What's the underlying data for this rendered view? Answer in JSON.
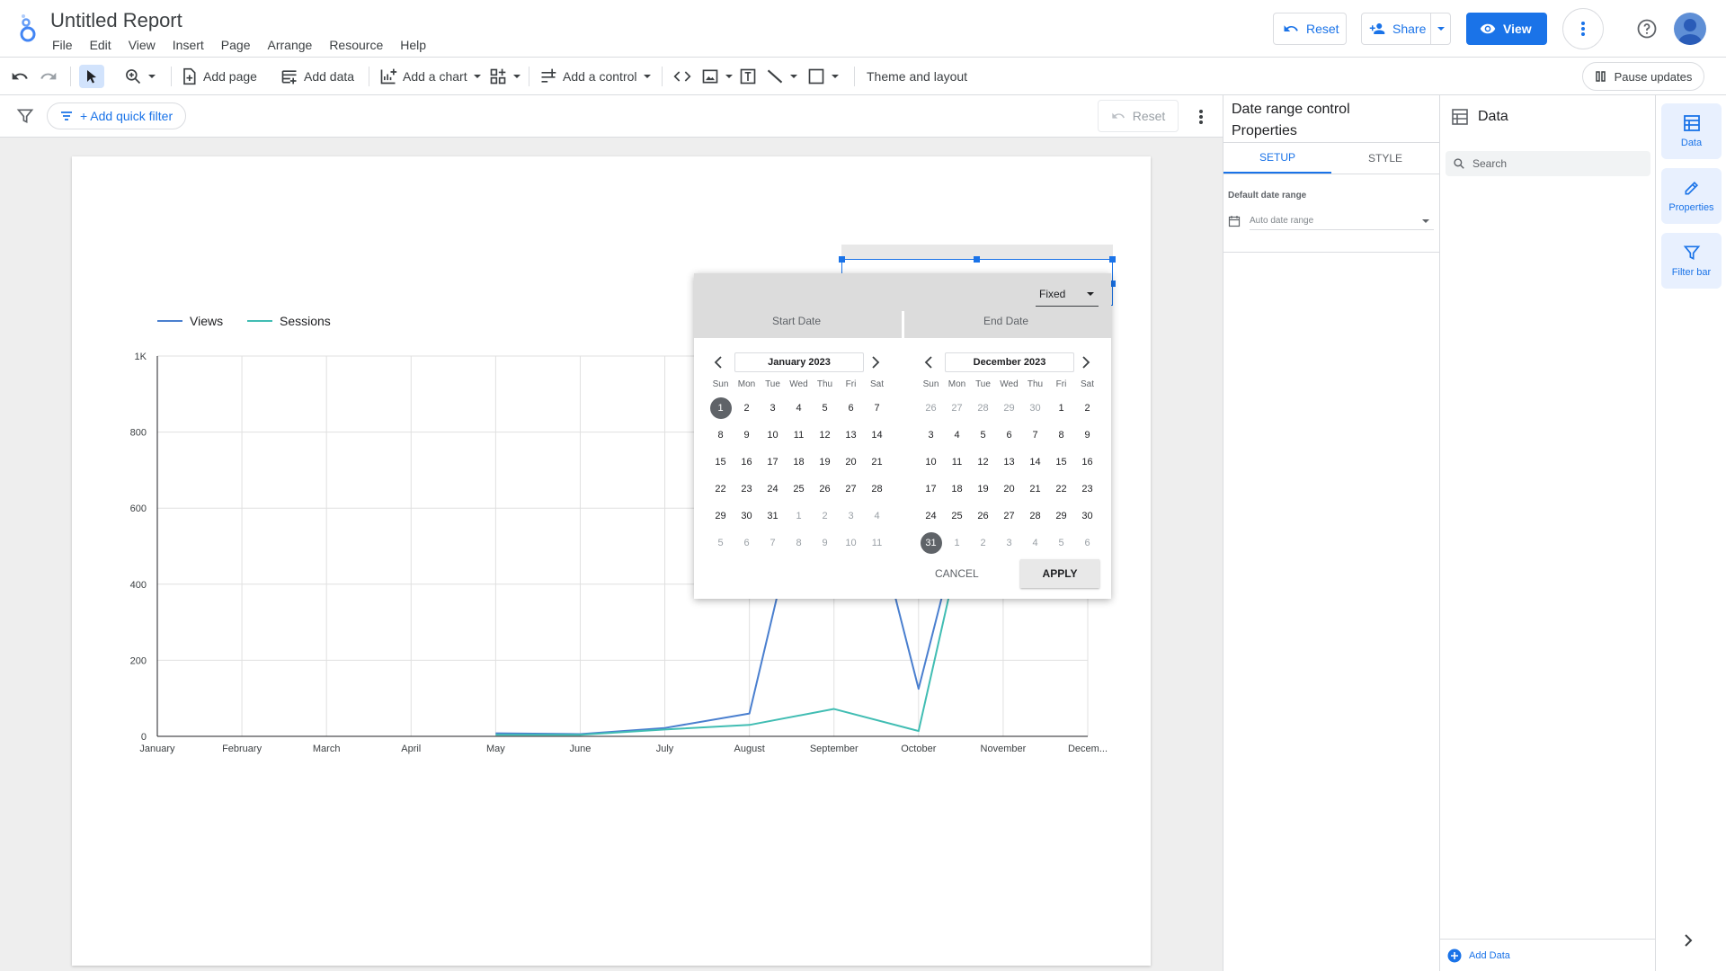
{
  "app": {
    "title": "Untitled Report",
    "menu": [
      "File",
      "Edit",
      "View",
      "Insert",
      "Page",
      "Arrange",
      "Resource",
      "Help"
    ],
    "buttons": {
      "reset": "Reset",
      "share": "Share",
      "view": "View"
    }
  },
  "toolbar": {
    "add_page": "Add page",
    "add_data": "Add data",
    "add_chart": "Add a chart",
    "add_control": "Add a control",
    "theme": "Theme and layout",
    "pause": "Pause updates"
  },
  "filterbar": {
    "quick_filter": "+ Add quick filter",
    "reset": "Reset"
  },
  "props": {
    "title_line1": "Date range control",
    "title_line2": "Properties",
    "tabs": [
      "SETUP",
      "STYLE"
    ],
    "default_label": "Default date range",
    "default_value": "Auto date range"
  },
  "data_panel": {
    "title": "Data",
    "search_placeholder": "Search",
    "add_data": "Add Data"
  },
  "rail": {
    "data": "Data",
    "properties": "Properties",
    "filter_bar": "Filter bar"
  },
  "date_popup": {
    "mode": "Fixed",
    "start_label": "Start Date",
    "end_label": "End Date",
    "cancel": "CANCEL",
    "apply": "APPLY",
    "dow": [
      "Sun",
      "Mon",
      "Tue",
      "Wed",
      "Thu",
      "Fri",
      "Sat"
    ],
    "start_month": "January 2023",
    "end_month": "December 2023",
    "start_days": [
      [
        "1",
        "c",
        "s"
      ],
      [
        "2",
        "c"
      ],
      [
        "3",
        "c"
      ],
      [
        "4",
        "c"
      ],
      [
        "5",
        "c"
      ],
      [
        "6",
        "c"
      ],
      [
        "7",
        "c"
      ],
      [
        "8",
        "c"
      ],
      [
        "9",
        "c"
      ],
      [
        "10",
        "c"
      ],
      [
        "11",
        "c"
      ],
      [
        "12",
        "c"
      ],
      [
        "13",
        "c"
      ],
      [
        "14",
        "c"
      ],
      [
        "15",
        "c"
      ],
      [
        "16",
        "c"
      ],
      [
        "17",
        "c"
      ],
      [
        "18",
        "c"
      ],
      [
        "19",
        "c"
      ],
      [
        "20",
        "c"
      ],
      [
        "21",
        "c"
      ],
      [
        "22",
        "c"
      ],
      [
        "23",
        "c"
      ],
      [
        "24",
        "c"
      ],
      [
        "25",
        "c"
      ],
      [
        "26",
        "c"
      ],
      [
        "27",
        "c"
      ],
      [
        "28",
        "c"
      ],
      [
        "29",
        "c"
      ],
      [
        "30",
        "c"
      ],
      [
        "31",
        "c"
      ],
      [
        "1",
        "o"
      ],
      [
        "2",
        "o"
      ],
      [
        "3",
        "o"
      ],
      [
        "4",
        "o"
      ],
      [
        "5",
        "o"
      ],
      [
        "6",
        "o"
      ],
      [
        "7",
        "o"
      ],
      [
        "8",
        "o"
      ],
      [
        "9",
        "o"
      ],
      [
        "10",
        "o"
      ],
      [
        "11",
        "o"
      ]
    ],
    "end_days": [
      [
        "26",
        "o"
      ],
      [
        "27",
        "o"
      ],
      [
        "28",
        "o"
      ],
      [
        "29",
        "o"
      ],
      [
        "30",
        "o"
      ],
      [
        "1",
        "c"
      ],
      [
        "2",
        "c"
      ],
      [
        "3",
        "c"
      ],
      [
        "4",
        "c"
      ],
      [
        "5",
        "c"
      ],
      [
        "6",
        "c"
      ],
      [
        "7",
        "c"
      ],
      [
        "8",
        "c"
      ],
      [
        "9",
        "c"
      ],
      [
        "10",
        "c"
      ],
      [
        "11",
        "c"
      ],
      [
        "12",
        "c"
      ],
      [
        "13",
        "c"
      ],
      [
        "14",
        "c"
      ],
      [
        "15",
        "c"
      ],
      [
        "16",
        "c"
      ],
      [
        "17",
        "c"
      ],
      [
        "18",
        "c"
      ],
      [
        "19",
        "c"
      ],
      [
        "20",
        "c"
      ],
      [
        "21",
        "c"
      ],
      [
        "22",
        "c"
      ],
      [
        "23",
        "c"
      ],
      [
        "24",
        "c"
      ],
      [
        "25",
        "c"
      ],
      [
        "26",
        "c"
      ],
      [
        "27",
        "c"
      ],
      [
        "28",
        "c"
      ],
      [
        "29",
        "c"
      ],
      [
        "30",
        "c"
      ],
      [
        "31",
        "c",
        "s"
      ],
      [
        "1",
        "o"
      ],
      [
        "2",
        "o"
      ],
      [
        "3",
        "o"
      ],
      [
        "4",
        "o"
      ],
      [
        "5",
        "o"
      ],
      [
        "6",
        "o"
      ]
    ]
  },
  "chart_data": {
    "type": "line",
    "categories": [
      "January",
      "February",
      "March",
      "April",
      "May",
      "June",
      "July",
      "August",
      "September",
      "October",
      "November",
      "Decem..."
    ],
    "series": [
      {
        "name": "Views",
        "color": "#4a7fcf",
        "values": [
          null,
          null,
          null,
          null,
          8,
          6,
          22,
          60,
          1000,
          125,
          1000,
          1000
        ]
      },
      {
        "name": "Sessions",
        "color": "#41bdb3",
        "values": [
          null,
          null,
          null,
          null,
          4,
          4,
          18,
          30,
          72,
          14,
          1000,
          1000
        ]
      }
    ],
    "yticks": [
      "0",
      "200",
      "400",
      "600",
      "800",
      "1K"
    ],
    "ylim": [
      0,
      1000
    ],
    "grid": true,
    "legend": "top-left"
  }
}
